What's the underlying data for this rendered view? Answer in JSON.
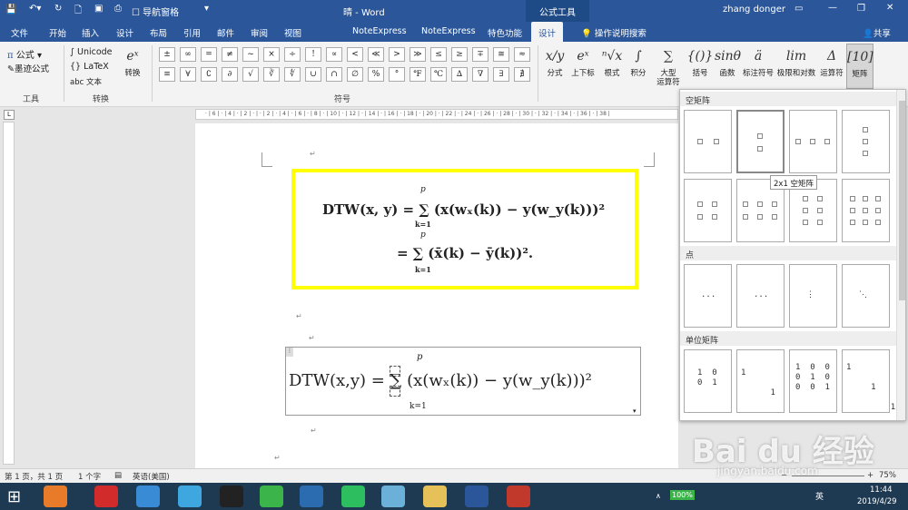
{
  "window": {
    "title": "晴 - Word",
    "context_tab": "公式工具",
    "user": "zhang donger",
    "quick_access": "导航窗格"
  },
  "tabs": [
    "文件",
    "开始",
    "插入",
    "设计",
    "布局",
    "引用",
    "邮件",
    "审阅",
    "视图",
    "NoteExpress",
    "NoteExpress",
    "特色功能",
    "设计",
    "操作说明搜索",
    "共享"
  ],
  "ribbon": {
    "tools": {
      "equation": "公式",
      "ink": "墨迹公式",
      "label": "工具"
    },
    "convert": {
      "unicode": "Unicode",
      "latex": "LaTeX",
      "text": "abc 文本",
      "convert_btn": "转换",
      "label": "转换"
    },
    "symbols": {
      "row1": [
        "±",
        "∞",
        "=",
        "≠",
        "~",
        "×",
        "÷",
        "!",
        "∝",
        "<",
        "≪",
        ">",
        "≫",
        "≤",
        "≥",
        "∓",
        "≅",
        "≈"
      ],
      "row2": [
        "≡",
        "∀",
        "∁",
        "∂",
        "√",
        "∛",
        "∜",
        "∪",
        "∩",
        "∅",
        "%",
        "°",
        "℉",
        "℃",
        "∆",
        "∇",
        "∃",
        "∄"
      ],
      "label": "符号"
    },
    "structures": [
      {
        "icon": "x/y",
        "label": "分式"
      },
      {
        "icon": "eˣ",
        "label": "上下标"
      },
      {
        "icon": "ⁿ√x",
        "label": "根式"
      },
      {
        "icon": "∫",
        "label": "积分"
      },
      {
        "icon": "∑",
        "label": "大型\n运算符"
      },
      {
        "icon": "{()}",
        "label": "括号"
      },
      {
        "icon": "sinθ",
        "label": "函数"
      },
      {
        "icon": "ä",
        "label": "标注符号"
      },
      {
        "icon": "lim",
        "label": "极限和对数"
      },
      {
        "icon": "Δ",
        "label": "运算符"
      },
      {
        "icon": "[10]",
        "label": "矩阵"
      }
    ]
  },
  "document": {
    "eq1_line1": "DTW(x, y) = ∑ (x(wₓ(k)) − y(w_y(k)))²",
    "eq1_line2": "= ∑ (x̄(k) − ȳ(k))².",
    "eq2": "DTW(x,y) = ∑ (x(wₓ(k)) − y(w_y(k)))²",
    "sum_top": "p",
    "sum_bottom": "k=1",
    "paragraph_mark": "↵"
  },
  "gallery": {
    "sections": [
      "空矩阵",
      "点",
      "单位矩阵"
    ],
    "tooltip": "2x1 空矩阵",
    "dots": [
      "...",
      "...",
      "⋮",
      "⋱"
    ],
    "identity": [
      "1  0\n0  1",
      "1\n\n      1",
      "1  0  0\n0  1  0\n0  0  1",
      "1\n\n     1\n\n         1"
    ]
  },
  "status": {
    "page": "第 1 页，共 1 页",
    "words": "1 个字",
    "lang": "英语(美国)",
    "zoom": "75%"
  },
  "taskbar": {
    "battery": "100%",
    "time": "11:44",
    "date": "2019/4/29",
    "ime": "英"
  },
  "watermark": {
    "brand": "Bai du 经验",
    "url": "jingyan.baidu.com"
  }
}
